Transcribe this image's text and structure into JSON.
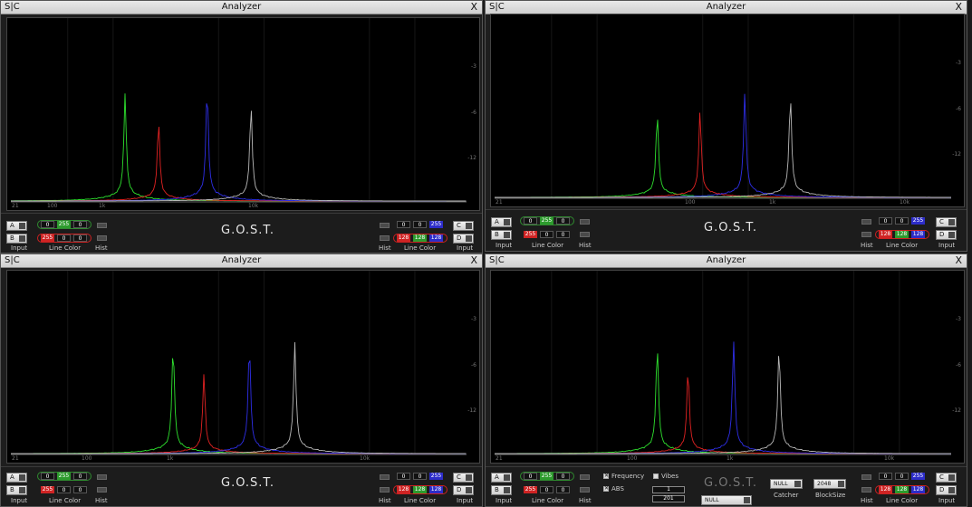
{
  "common": {
    "sc_label": "S|C",
    "title": "Analyzer",
    "close_label": "X",
    "db_labels": [
      "-3",
      "-6",
      "-12"
    ],
    "freq_labels": [
      "21",
      "100",
      "1k",
      "10k"
    ],
    "brand": "G.O.S.T.",
    "left": {
      "a_label": "A",
      "b_label": "B",
      "a_rgb": [
        "0",
        "255",
        "0"
      ],
      "b_rgb": [
        "255",
        "0",
        "0"
      ],
      "input_label": "Input",
      "line_color_label": "Line Color",
      "hist_label": "Hist"
    },
    "right": {
      "c_label": "C",
      "d_label": "D",
      "c_rgb": [
        "0",
        "0",
        "255"
      ],
      "d_rgb": [
        "128",
        "128",
        "128"
      ],
      "input_label": "Input",
      "line_color_label": "Line Color",
      "hist_label": "Hist"
    }
  },
  "extras": {
    "frequency_label": "Frequency",
    "vibes_label": "Vibes",
    "abs_label": "ABS",
    "field1": "1",
    "field2": "201",
    "null_field": "NULL",
    "catcher_value": "NULL",
    "catcher_label": "Catcher",
    "blocksize_value": "2048",
    "blocksize_label": "BlockSize"
  },
  "colors": {
    "green": "#2ee02e",
    "red": "#e02222",
    "blue": "#2e2ee6",
    "grey": "#b8b8b8"
  },
  "chart_data": [
    {
      "type": "line",
      "x_scale": "log",
      "xlim": [
        21,
        22000
      ],
      "y_scale": "db",
      "series": [
        {
          "color": "#2ee02e",
          "peak_freq": 120,
          "peak_level": 0.6
        },
        {
          "color": "#e02222",
          "peak_freq": 200,
          "peak_level": 0.45
        },
        {
          "color": "#2e2ee6",
          "peak_freq": 420,
          "peak_level": 0.64
        },
        {
          "color": "#b8b8b8",
          "peak_freq": 820,
          "peak_level": 0.54
        }
      ]
    },
    {
      "type": "line",
      "x_scale": "log",
      "xlim": [
        21,
        22000
      ],
      "y_scale": "db",
      "series": [
        {
          "color": "#2ee02e",
          "peak_freq": 250,
          "peak_level": 0.48
        },
        {
          "color": "#e02222",
          "peak_freq": 480,
          "peak_level": 0.49
        },
        {
          "color": "#2e2ee6",
          "peak_freq": 950,
          "peak_level": 0.6
        },
        {
          "color": "#b8b8b8",
          "peak_freq": 1900,
          "peak_level": 0.58
        }
      ]
    },
    {
      "type": "line",
      "x_scale": "log",
      "xlim": [
        21,
        22000
      ],
      "y_scale": "db",
      "series": [
        {
          "color": "#2ee02e",
          "peak_freq": 250,
          "peak_level": 0.62
        },
        {
          "color": "#e02222",
          "peak_freq": 400,
          "peak_level": 0.45
        },
        {
          "color": "#2e2ee6",
          "peak_freq": 800,
          "peak_level": 0.62
        },
        {
          "color": "#b8b8b8",
          "peak_freq": 1600,
          "peak_level": 0.63
        }
      ]
    },
    {
      "type": "line",
      "x_scale": "log",
      "xlim": [
        21,
        22000
      ],
      "y_scale": "db",
      "series": [
        {
          "color": "#2ee02e",
          "peak_freq": 250,
          "peak_level": 0.62
        },
        {
          "color": "#e02222",
          "peak_freq": 400,
          "peak_level": 0.48
        },
        {
          "color": "#2e2ee6",
          "peak_freq": 800,
          "peak_level": 0.64
        },
        {
          "color": "#b8b8b8",
          "peak_freq": 1600,
          "peak_level": 0.61
        }
      ]
    }
  ]
}
